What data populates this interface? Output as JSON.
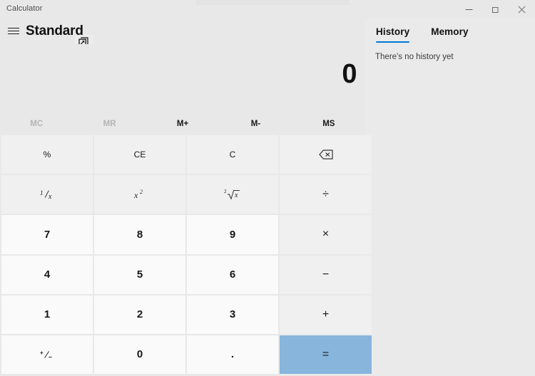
{
  "window": {
    "app_title": "Calculator",
    "controls": [
      {
        "name": "minimize",
        "label": "Minimize"
      },
      {
        "name": "restore",
        "label": "Restore Down"
      },
      {
        "name": "close",
        "label": "Close"
      }
    ]
  },
  "header": {
    "menu_label": "Open Navigation",
    "mode_title": "Standard",
    "keep_on_top_label": "Keep on top"
  },
  "side_panel": {
    "tabs": [
      {
        "label": "History",
        "active": true
      },
      {
        "label": "Memory",
        "active": false
      }
    ],
    "empty_message": "There's no history yet"
  },
  "display": {
    "expression": "",
    "result": "0"
  },
  "memory_buttons": [
    {
      "label": "MC",
      "enabled": false
    },
    {
      "label": "MR",
      "enabled": false
    },
    {
      "label": "M+",
      "enabled": true
    },
    {
      "label": "M-",
      "enabled": true
    },
    {
      "label": "MS",
      "enabled": true
    }
  ],
  "keypad": [
    {
      "label": "%",
      "name": "percent",
      "kind": "func"
    },
    {
      "label": "CE",
      "name": "clear-entry",
      "kind": "func"
    },
    {
      "label": "C",
      "name": "clear",
      "kind": "func"
    },
    {
      "label": "",
      "name": "backspace",
      "kind": "func",
      "icon": "backspace-icon"
    },
    {
      "label": "1/x",
      "name": "reciprocal",
      "kind": "func",
      "icon": "reciprocal-glyph"
    },
    {
      "label": "x²",
      "name": "square",
      "kind": "func",
      "icon": "square-glyph"
    },
    {
      "label": "²√x",
      "name": "square-root",
      "kind": "func",
      "icon": "sqrt-glyph"
    },
    {
      "label": "÷",
      "name": "divide",
      "kind": "op"
    },
    {
      "label": "7",
      "name": "seven",
      "kind": "num"
    },
    {
      "label": "8",
      "name": "eight",
      "kind": "num"
    },
    {
      "label": "9",
      "name": "nine",
      "kind": "num"
    },
    {
      "label": "×",
      "name": "multiply",
      "kind": "op"
    },
    {
      "label": "4",
      "name": "four",
      "kind": "num"
    },
    {
      "label": "5",
      "name": "five",
      "kind": "num"
    },
    {
      "label": "6",
      "name": "six",
      "kind": "num"
    },
    {
      "label": "−",
      "name": "subtract",
      "kind": "op"
    },
    {
      "label": "1",
      "name": "one",
      "kind": "num"
    },
    {
      "label": "2",
      "name": "two",
      "kind": "num"
    },
    {
      "label": "3",
      "name": "three",
      "kind": "num"
    },
    {
      "label": "+",
      "name": "add",
      "kind": "op"
    },
    {
      "label": "+/-",
      "name": "negate",
      "kind": "num",
      "icon": "negate-glyph"
    },
    {
      "label": "0",
      "name": "zero",
      "kind": "num"
    },
    {
      "label": ".",
      "name": "decimal-separator",
      "kind": "num"
    },
    {
      "label": "=",
      "name": "equals",
      "kind": "equals"
    }
  ],
  "colors": {
    "accent": "#0078d4",
    "equals_background": "#87b5dc",
    "window_background": "#e8e8e8",
    "key_number": "#fafafa",
    "key_function": "#f0f0f0",
    "text_primary": "#171717",
    "text_disabled": "#b4b4b4"
  }
}
